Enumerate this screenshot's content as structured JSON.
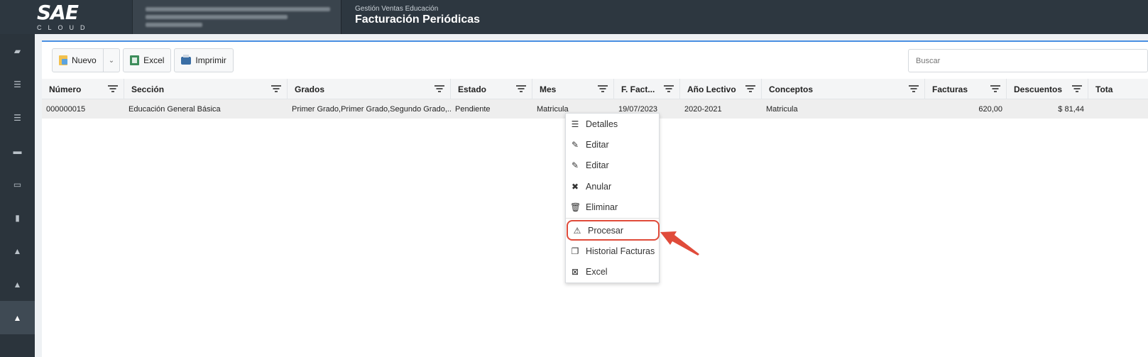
{
  "brand": {
    "logo_main": "SAE",
    "logo_sub": "CLOUD"
  },
  "module": {
    "subtitle": "Gestión Ventas Educación",
    "title": "Facturación Periódicas"
  },
  "toolbar": {
    "new_label": "Nuevo",
    "excel_label": "Excel",
    "print_label": "Imprimir"
  },
  "search": {
    "placeholder": "Buscar"
  },
  "columns": [
    {
      "label": "Número"
    },
    {
      "label": "Sección"
    },
    {
      "label": "Grados"
    },
    {
      "label": "Estado"
    },
    {
      "label": "Mes"
    },
    {
      "label": "F. Fact..."
    },
    {
      "label": "Año Lectivo"
    },
    {
      "label": "Conceptos"
    },
    {
      "label": "Facturas"
    },
    {
      "label": "Descuentos"
    },
    {
      "label": "Tota"
    }
  ],
  "row": {
    "numero": "000000015",
    "seccion": "Educación General Básica",
    "grados": "Primer Grado,Primer Grado,Segundo Grado,...",
    "estado": "Pendiente",
    "mes": "Matricula",
    "fecha": "19/07/2023",
    "anio": "2020-2021",
    "conceptos": "Matricula",
    "facturas": "620,00",
    "descuentos": "$ 81,44"
  },
  "menu": {
    "detalles": "Detalles",
    "editar1": "Editar",
    "editar2": "Editar",
    "anular": "Anular",
    "eliminar": "Eliminar",
    "procesar": "Procesar",
    "historial": "Historial Facturas",
    "excel": "Excel"
  },
  "colors": {
    "accent": "#4a90e2",
    "highlight": "#e04b3a",
    "topbar": "#2d3740"
  }
}
